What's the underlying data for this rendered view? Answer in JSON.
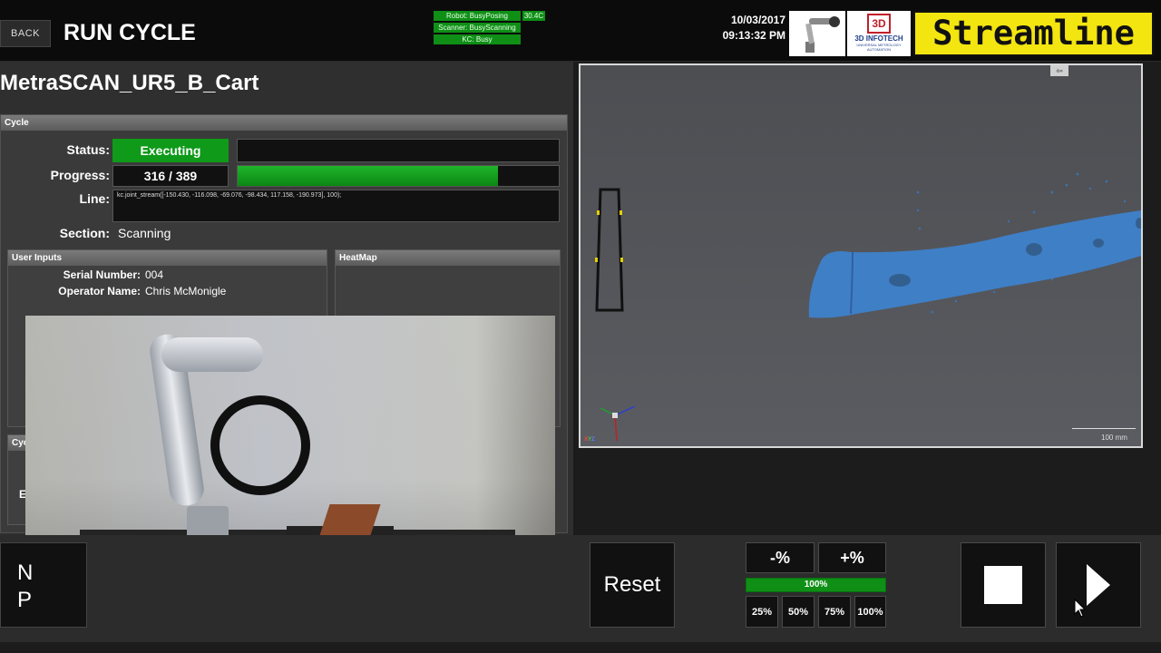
{
  "header": {
    "back_label": "BACK",
    "title": "RUN CYCLE",
    "status_lines": [
      "Robot: BusyPosing",
      "Scanner: BusyScanning",
      "KC: Busy"
    ],
    "temperature": "30.4C",
    "date": "10/03/2017",
    "time": "09:13:32 PM",
    "infotech_logo": {
      "mark": "3D",
      "name": "3D INFOTECH",
      "sub": "UNIVERSAL METROLOGY AUTOMATION"
    },
    "brand": "Streamline",
    "colors": {
      "brand_bg": "#f3e50f",
      "status_green": "#0f8f16"
    }
  },
  "config_name": "MetraSCAN_UR5_B_Cart",
  "cycle": {
    "header": "Cycle",
    "status_label": "Status:",
    "status_value": "Executing",
    "progress_label": "Progress:",
    "progress_text": "316 / 389",
    "progress_fraction": 0.812,
    "line_label": "Line:",
    "line_value": "kc.joint_stream([-150.430, -116.098, -69.076, -98.434, 117.158, -190.973], 100);",
    "section_label": "Section:",
    "section_value": "Scanning"
  },
  "user_inputs": {
    "header": "User Inputs",
    "fields": [
      {
        "label": "Serial Number:",
        "value": "004"
      },
      {
        "label": "Operator Name:",
        "value": "Chris McMonigle"
      }
    ]
  },
  "heatmap": {
    "header": "HeatMap"
  },
  "cycle_sub": {
    "header": "Cyc",
    "el_text": "El"
  },
  "viewer": {
    "tab_glyph": "⇦",
    "scale_label": "100 mm",
    "axis_label": "XYZ"
  },
  "controls": {
    "left_button_text": [
      "N",
      "P"
    ],
    "reset_label": "Reset",
    "speed_minus": "-%",
    "speed_plus": "+%",
    "speed_value": "100%",
    "speed_presets": [
      "25%",
      "50%",
      "75%",
      "100%"
    ]
  },
  "icons": {
    "stop": "stop-icon",
    "play": "play-icon",
    "cursor": "mouse-cursor-icon"
  }
}
